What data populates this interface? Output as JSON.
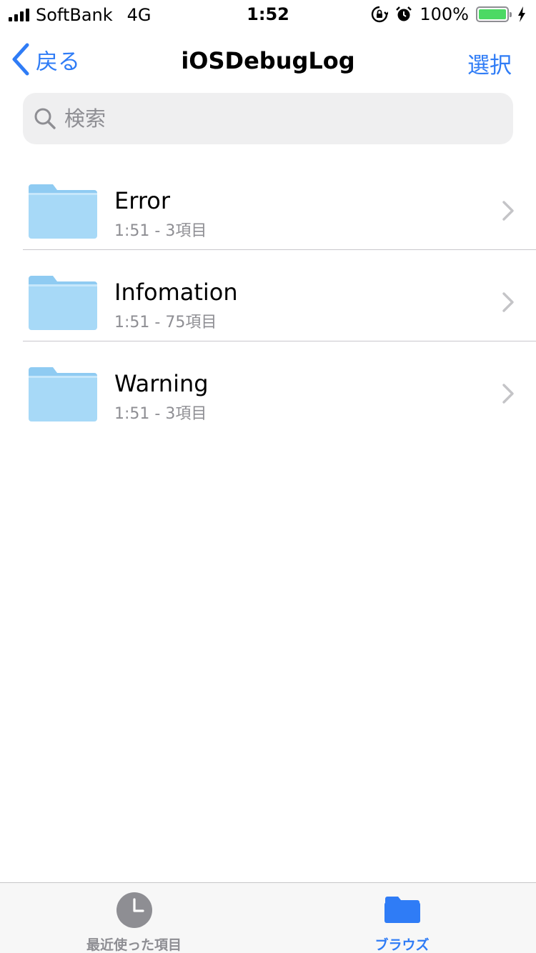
{
  "status_bar": {
    "carrier": "SoftBank",
    "network": "4G",
    "time": "1:52",
    "battery": "100%",
    "icons": [
      "signal-icon",
      "rotation-lock-icon",
      "alarm-icon",
      "battery-icon",
      "charging-bolt-icon"
    ],
    "battery_level": 1.0
  },
  "nav": {
    "back_label": "戻る",
    "title": "iOSDebugLog",
    "select_label": "選択"
  },
  "search": {
    "placeholder": "検索",
    "value": ""
  },
  "folders": [
    {
      "name": "Error",
      "meta": "1:51 - 3項目"
    },
    {
      "name": "Infomation",
      "meta": "1:51 - 75項目"
    },
    {
      "name": "Warning",
      "meta": "1:51 - 3項目"
    }
  ],
  "tabbar": {
    "recent_label": "最近使った項目",
    "browse_label": "ブラウズ",
    "selected": "browse"
  },
  "colors": {
    "accent": "#2f7cf6",
    "folder_light": "#a7d9f7",
    "folder_dark": "#8fcbf2",
    "battery_fill": "#4cd964",
    "secondary_text": "#8e8e93"
  }
}
